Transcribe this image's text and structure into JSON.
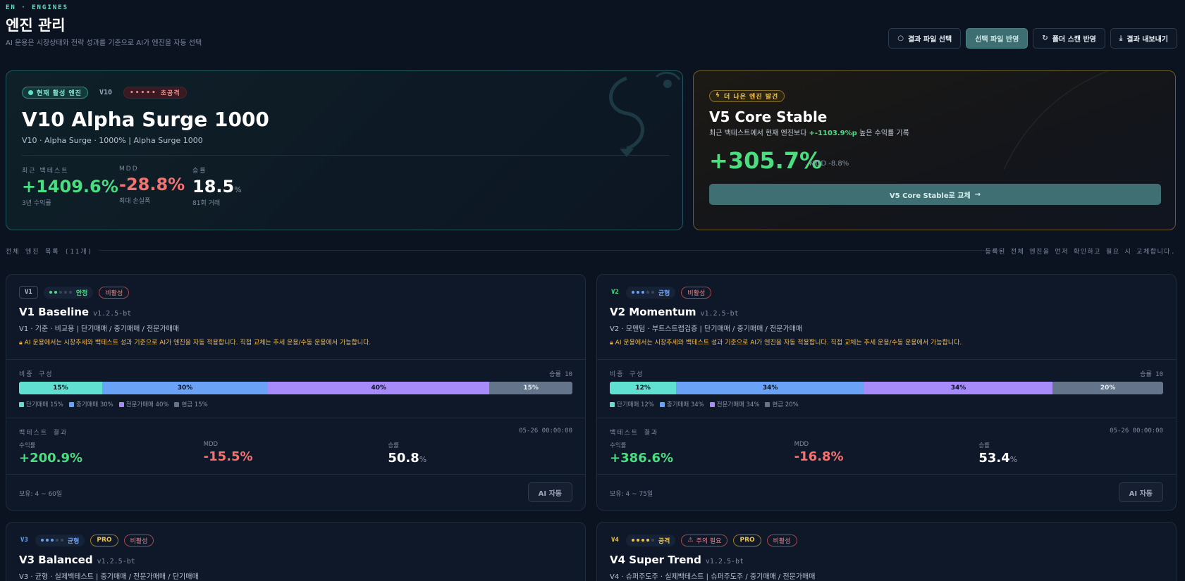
{
  "header": {
    "crumb": "EN · ENGINES",
    "title": "엔진 관리",
    "subtitle": "AI 운용은 시장상태와 전략 성과를 기준으로 AI가 엔진을 자동 선택"
  },
  "toolbar": {
    "select_result": "결과 파일 선택",
    "apply_selected": "선택 파일 반영",
    "folder_scan": "폴더 스캔 반영",
    "export": "결과 내보내기"
  },
  "active": {
    "badge": "현재 활성 엔진",
    "version": "V10",
    "risk_label": "초공격",
    "title": "V10 Alpha Surge 1000",
    "desc": "V10 · Alpha Surge · 1000% | Alpha Surge 1000",
    "stats": [
      {
        "label": "최근 백테스트",
        "value": "+1409.6%",
        "sub": "3년 수익률"
      },
      {
        "label": "MDD",
        "value": "-28.8%",
        "sub": "최대 손실폭"
      },
      {
        "label": "승률",
        "value": "18.5",
        "unit": "%",
        "sub": "81회 거래"
      }
    ]
  },
  "better": {
    "badge": "더 나은 엔진 발견",
    "title": "V5 Core Stable",
    "desc_pre": "최근 백테스트에서 현재 엔진보다 ",
    "desc_highlight": "+-1103.9%p",
    "desc_post": " 높은 수익률 기록",
    "value": "+305.7%",
    "mdd": "MDD -8.8%",
    "button": "V5 Core Stable로 교체"
  },
  "section": {
    "label": "전체 엔진 목록 (11개)",
    "note": "등록된 전체 엔진을 먼저 확인하고 필요 시 교체합니다."
  },
  "engines": [
    {
      "version": "V1",
      "risk": "안정",
      "status": "비활성",
      "title": "V1 Baseline",
      "ver": "v1.2.5-bt",
      "desc": "V1 · 기준 · 비교용 | 단기매매 / 중기매매 / 전문가매매",
      "notice": "AI 운용에서는 시장추세와 백테스트 성과 기준으로 AI가 엔진을 자동 적용합니다. 직접 교체는 추세 운용/수동 운용에서 가능합니다.",
      "alloc_label": "비중 구성",
      "alloc_right": "승률 10",
      "alloc": [
        15,
        30,
        40,
        15
      ],
      "alloc_text": [
        "15%",
        "30%",
        "40%",
        "15%"
      ],
      "legend": [
        "단기매매 15%",
        "중기매매 30%",
        "전문가매매 40%",
        "현금 15%"
      ],
      "bt_label": "백테스트 결과",
      "bt_time": "05-26 00:00:00",
      "bt": {
        "return_label": "수익률",
        "return": "+200.9%",
        "mdd_label": "MDD",
        "mdd": "-15.5%",
        "win_label": "승률",
        "win": "50.8",
        "win_unit": "%"
      },
      "hold": "보유: 4 ~ 60일",
      "ai_button": "AI 자동"
    },
    {
      "version": "V2",
      "risk": "균형",
      "status": "비활성",
      "title": "V2 Momentum",
      "ver": "v1.2.5-bt",
      "desc": "V2 · 모멘텀 · 부트스트랩검증 | 단기매매 / 중기매매 / 전문가매매",
      "notice": "AI 운용에서는 시장추세와 백테스트 성과 기준으로 AI가 엔진을 자동 적용합니다. 직접 교체는 추세 운용/수동 운용에서 가능합니다.",
      "alloc_label": "비중 구성",
      "alloc_right": "승률 10",
      "alloc": [
        12,
        34,
        34,
        20
      ],
      "alloc_text": [
        "12%",
        "34%",
        "34%",
        "20%"
      ],
      "legend": [
        "단기매매 12%",
        "중기매매 34%",
        "전문가매매 34%",
        "현금 20%"
      ],
      "bt_label": "백테스트 결과",
      "bt_time": "05-26 00:00:00",
      "bt": {
        "return_label": "수익률",
        "return": "+386.6%",
        "mdd_label": "MDD",
        "mdd": "-16.8%",
        "win_label": "승률",
        "win": "53.4",
        "win_unit": "%"
      },
      "hold": "보유: 4 ~ 75일",
      "ai_button": "AI 자동"
    },
    {
      "version": "V3",
      "risk": "균형",
      "pro": "PRO",
      "status": "비활성",
      "title": "V3 Balanced",
      "ver": "v1.2.5-bt",
      "desc": "V3 · 균형 · 실제백테스트 | 중기매매 / 전문가매매 / 단기매매"
    },
    {
      "version": "V4",
      "risk": "공격",
      "warn": "주의 필요",
      "pro": "PRO",
      "status": "비활성",
      "title": "V4 Super Trend",
      "ver": "v1.2.5-bt",
      "desc": "V4 · 슈퍼주도주 · 실제백테스트 | 슈퍼주도주 / 중기매매 / 전문가매매"
    }
  ],
  "colors": {
    "accent": "#5fe0c9",
    "positive": "#4ade80",
    "negative": "#f87171",
    "seg_short": "#5fe0d0",
    "seg_mid": "#6aa2f5",
    "seg_expert": "#a78bfa",
    "seg_cash": "#64748b"
  }
}
